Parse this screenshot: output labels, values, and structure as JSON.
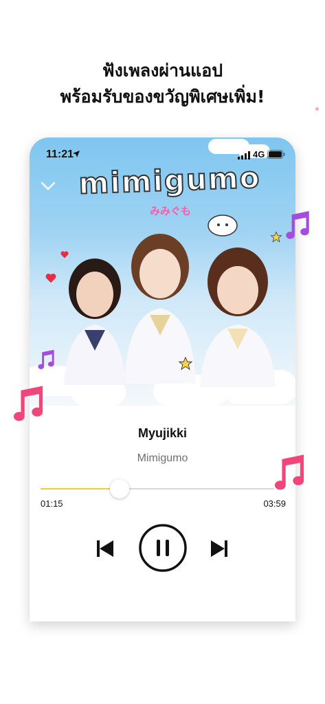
{
  "headline": {
    "line1": "ฟังเพลงผ่านแอป",
    "line2": "พร้อมรับของขวัญพิเศษเพิ่ม!"
  },
  "status_bar": {
    "time": "11:21",
    "network": "4G"
  },
  "album_art": {
    "logo": "mimigumo",
    "logo_sub": "みみぐも"
  },
  "player": {
    "title": "Myujikki",
    "artist": "Mimigumo",
    "elapsed": "01:15",
    "total": "03:59",
    "progress": 0.31
  },
  "colors": {
    "progress": "#f3c64b",
    "note_pink": "#f2467a",
    "note_purple": "#a64be0"
  },
  "icons": [
    "location-arrow-icon",
    "signal-icon",
    "battery-icon",
    "chevron-down-icon",
    "previous-track-icon",
    "pause-icon",
    "next-track-icon",
    "music-note-icon"
  ]
}
